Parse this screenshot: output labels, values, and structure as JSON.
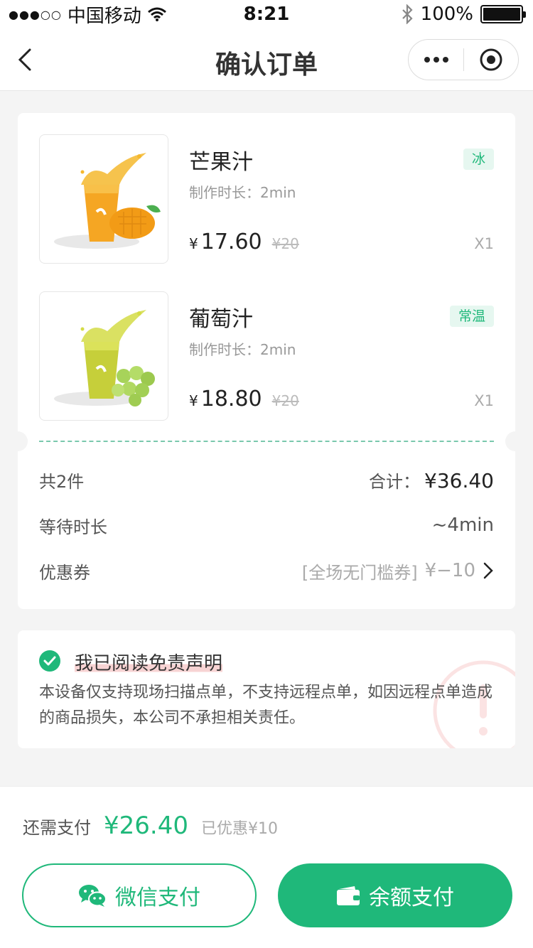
{
  "status_bar": {
    "carrier": "中国移动",
    "time": "8:21",
    "battery": "100%"
  },
  "nav": {
    "title": "确认订单"
  },
  "order": {
    "items": [
      {
        "name": "芒果汁",
        "duration": "制作时长：2min",
        "tag": "冰",
        "currency": "¥",
        "price": "17.60",
        "original_price": "¥20",
        "quantity": "X1"
      },
      {
        "name": "葡萄汁",
        "duration": "制作时长：2min",
        "tag": "常温",
        "currency": "¥",
        "price": "18.80",
        "original_price": "¥20",
        "quantity": "X1"
      }
    ],
    "count_label": "共2件",
    "total_label": "合计：",
    "total_value": "¥36.40",
    "wait_label": "等待时长",
    "wait_value": "~4min",
    "coupon_label": "优惠券",
    "coupon_name": "[全场无门槛券]",
    "coupon_amount": "¥−10"
  },
  "disclaimer": {
    "title": "我已阅读免责声明",
    "text": "本设备仅支持现场扫描点单，不支持远程点单，如因远程点单造成的商品损失，本公司不承担相关责任。"
  },
  "payment": {
    "need_label": "还需支付",
    "need_amount": "¥26.40",
    "saved": "已优惠¥10",
    "wechat_label": "微信支付",
    "balance_label": "余额支付"
  },
  "colors": {
    "accent": "#1fb87a",
    "tag_bg": "#e6f7f0"
  },
  "icons": [
    "wifi-icon",
    "bluetooth-icon",
    "back-icon",
    "more-icon",
    "close-target-icon",
    "check-circle-icon",
    "chevron-right-icon",
    "wechat-icon",
    "wallet-icon",
    "warning-watermark-icon"
  ]
}
